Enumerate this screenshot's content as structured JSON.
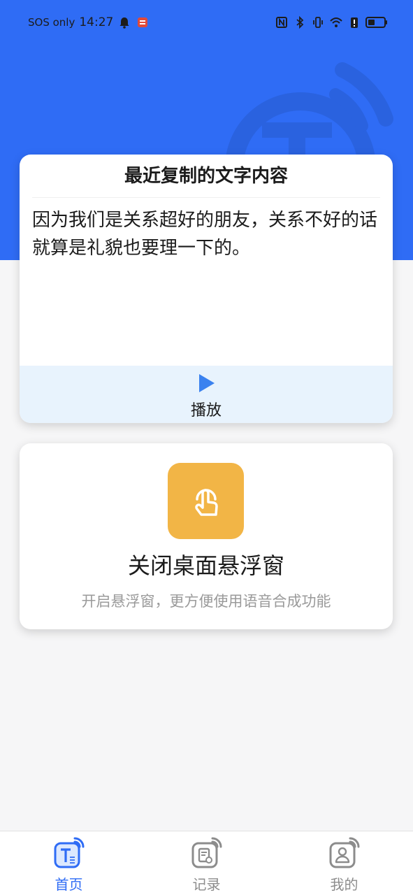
{
  "status_bar": {
    "carrier": "SOS only",
    "time": "14:27",
    "icons": [
      "bell-icon",
      "app-notification-icon",
      "nfc-icon",
      "bluetooth-icon",
      "vibrate-icon",
      "wifi-icon",
      "alert-icon",
      "battery-icon"
    ]
  },
  "colors": {
    "primary": "#2f6cf5",
    "accent_orange": "#f2b546",
    "play_area": "#e8f3fd"
  },
  "clipboard_card": {
    "title": "最近复制的文字内容",
    "content": "因为我们是关系超好的朋友，关系不好的话就算是礼貌也要理一下的。",
    "play_label": "播放",
    "play_icon": "play-icon"
  },
  "float_card": {
    "icon": "tap-gesture-icon",
    "title": "关闭桌面悬浮窗",
    "subtitle": "开启悬浮窗，更方便使用语音合成功能"
  },
  "bottom_nav": {
    "items": [
      {
        "label": "首页",
        "icon": "home-tts-icon",
        "active": true
      },
      {
        "label": "记录",
        "icon": "record-icon",
        "active": false
      },
      {
        "label": "我的",
        "icon": "profile-icon",
        "active": false
      }
    ]
  }
}
